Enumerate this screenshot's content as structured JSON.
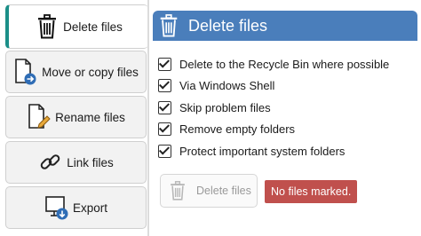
{
  "sidebar": {
    "items": [
      {
        "label": "Delete files",
        "icon": "trash-icon"
      },
      {
        "label": "Move or copy files",
        "icon": "document-arrow-icon"
      },
      {
        "label": "Rename files",
        "icon": "document-pencil-icon"
      },
      {
        "label": "Link files",
        "icon": "link-icon"
      },
      {
        "label": "Export",
        "icon": "monitor-download-icon"
      }
    ],
    "accent_color": "#1b8f88"
  },
  "panel": {
    "title": "Delete files",
    "header_color": "#4a7ebb",
    "options": [
      {
        "label": "Delete to the Recycle Bin where possible",
        "checked": true
      },
      {
        "label": "Via Windows Shell",
        "checked": true
      },
      {
        "label": "Skip problem files",
        "checked": true
      },
      {
        "label": "Remove empty folders",
        "checked": true
      },
      {
        "label": "Protect important system folders",
        "checked": true
      }
    ],
    "delete_button": {
      "label": "Delete files",
      "enabled": false
    },
    "status": {
      "text": "No files marked.",
      "color": "#c0504d"
    }
  }
}
